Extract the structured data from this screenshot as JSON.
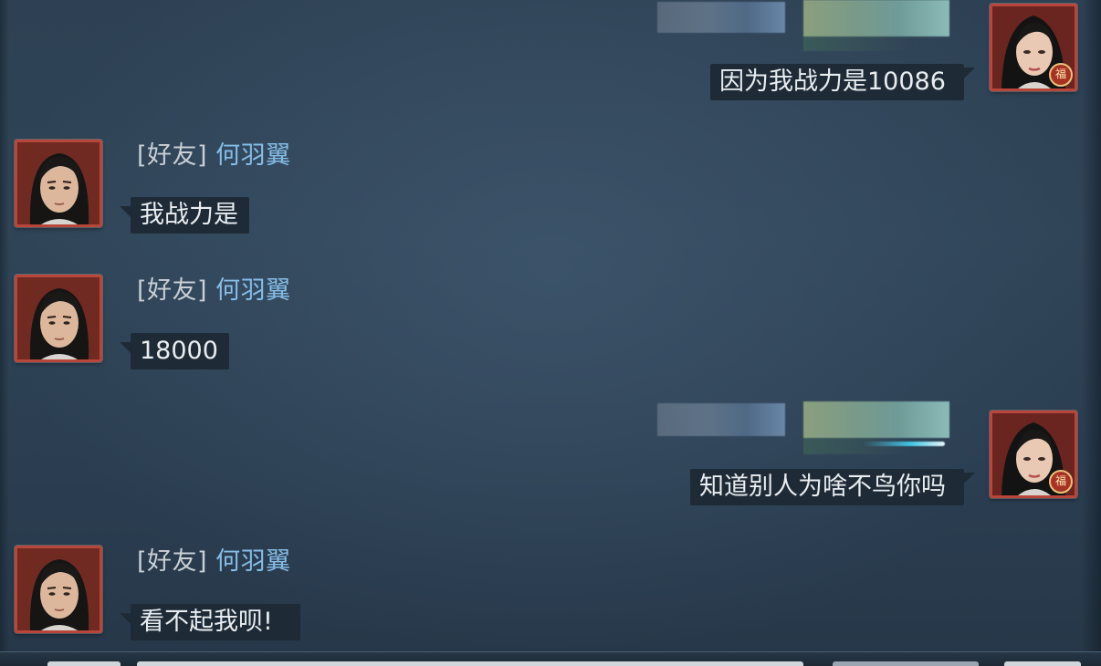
{
  "messages": [
    {
      "side": "right",
      "sender_obscured": true,
      "text": "因为我战力是10086"
    },
    {
      "side": "left",
      "tag": "[好友]",
      "name": "何羽翼",
      "text": "我战力是"
    },
    {
      "side": "left",
      "tag": "[好友]",
      "name": "何羽翼",
      "text": "18000"
    },
    {
      "side": "right",
      "sender_obscured": true,
      "text": "知道别人为啥不鸟你吗"
    },
    {
      "side": "left",
      "tag": "[好友]",
      "name": "何羽翼",
      "text": "看不起我呗!"
    }
  ],
  "avatar_badge": "福",
  "colors": {
    "background": "#2f4457",
    "bubble": "#1e2b37",
    "friend_name": "#86bde7",
    "tag": "#c9cfd5",
    "avatar_frame": "#b8463a"
  },
  "icons": {
    "male_avatar": "male-character-portrait",
    "female_avatar": "female-character-portrait",
    "badge": "fu-badge-icon"
  }
}
